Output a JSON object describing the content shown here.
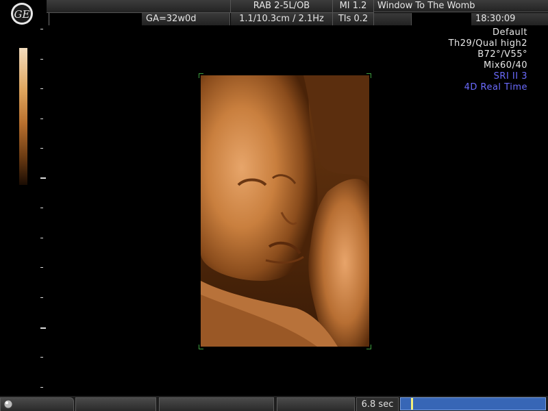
{
  "header": {
    "probe": "RAB 2-5L/OB",
    "mi": "MI  1.2",
    "site": "Window To The Womb",
    "ga": "GA=32w0d",
    "depth_freq": "1.1/10.3cm / 2.1Hz",
    "tis": "TIs  0.2",
    "time": "18:30:09"
  },
  "params": {
    "line1": "Default",
    "line2": "Th29/Qual high2",
    "line3": "B72°/V55°",
    "line4": "Mix60/40",
    "line5": "SRI II 3",
    "line6": "4D Real Time"
  },
  "colors": {
    "param_blue": "#6b6bff",
    "cine_bar": "#3766b6",
    "cine_cursor": "#f4f07a",
    "frame_corner": "#3f9f3f"
  },
  "cine": {
    "duration": "6.8 sec",
    "position_fraction": 0.07
  },
  "icons": {
    "logo": "ge-logo-icon",
    "footer": "trackball-icon"
  }
}
